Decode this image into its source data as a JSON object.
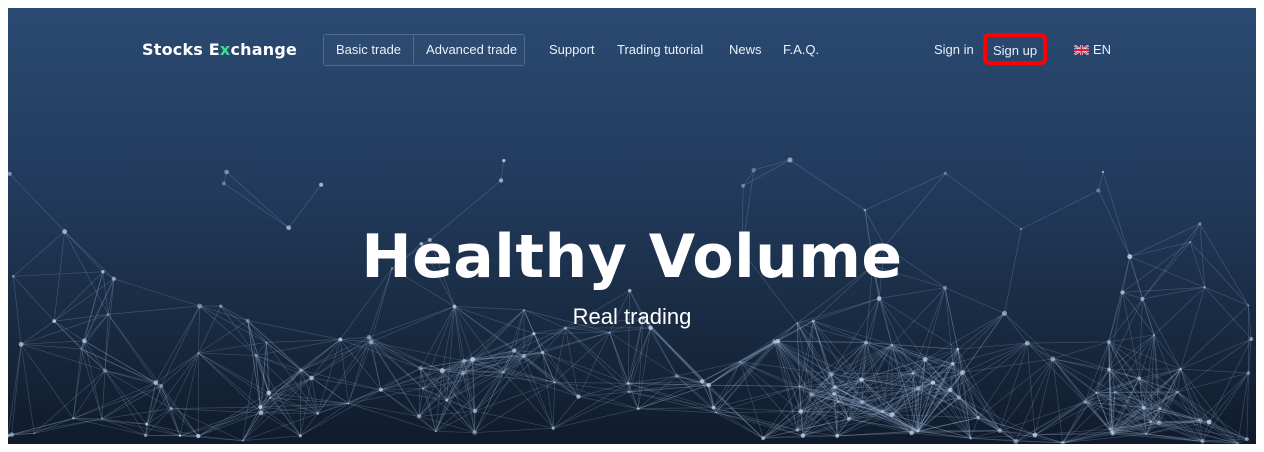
{
  "brand": {
    "logo_pre": "Stocks E",
    "logo_x": "x",
    "logo_post": "change",
    "logo_accent_color": "#3ddc8f"
  },
  "nav": {
    "trade_tabs": [
      {
        "label": "Basic trade"
      },
      {
        "label": "Advanced trade"
      }
    ],
    "links": [
      {
        "label": "Support"
      },
      {
        "label": "Trading tutorial"
      },
      {
        "label": "News"
      },
      {
        "label": "F.A.Q."
      }
    ],
    "sign_in": "Sign in",
    "sign_up": "Sign up",
    "language": {
      "flag_icon": "uk-flag-icon",
      "label": "EN"
    }
  },
  "hero": {
    "title": "Healthy Volume",
    "subtitle": "Real trading"
  },
  "highlight_color": "#ff0000",
  "background_colors": [
    "#2b4a72",
    "#0f1b2b"
  ]
}
